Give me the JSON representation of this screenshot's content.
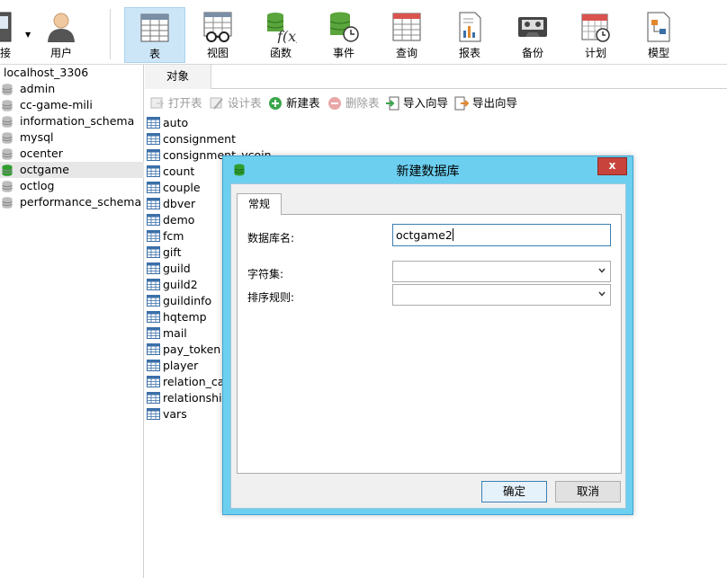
{
  "toolbar": {
    "partial_label": "接",
    "items": [
      {
        "label": "用户",
        "icon": "user-icon"
      },
      {
        "label": "表",
        "icon": "table-icon"
      },
      {
        "label": "视图",
        "icon": "view-icon"
      },
      {
        "label": "函数",
        "icon": "function-icon"
      },
      {
        "label": "事件",
        "icon": "event-icon"
      },
      {
        "label": "查询",
        "icon": "query-icon"
      },
      {
        "label": "报表",
        "icon": "report-icon"
      },
      {
        "label": "备份",
        "icon": "backup-icon"
      },
      {
        "label": "计划",
        "icon": "schedule-icon"
      },
      {
        "label": "模型",
        "icon": "model-icon"
      }
    ]
  },
  "tree": {
    "connection": "localhost_3306",
    "databases": [
      "admin",
      "cc-game-mili",
      "information_schema",
      "mysql",
      "ocenter",
      "octgame",
      "octlog",
      "performance_schema"
    ],
    "selected": "octgame"
  },
  "object_tab": "对象",
  "object_toolbar": {
    "open": "打开表",
    "design": "设计表",
    "new": "新建表",
    "delete": "删除表",
    "import": "导入向导",
    "export": "导出向导"
  },
  "tables": [
    "auto",
    "consignment",
    "consignment_ycoin",
    "count",
    "couple",
    "dbver",
    "demo",
    "fcm",
    "gift",
    "guild",
    "guild2",
    "guildinfo",
    "hqtemp",
    "mail",
    "pay_token",
    "player",
    "relation_cac",
    "relationship",
    "vars"
  ],
  "dialog": {
    "title": "新建数据库",
    "close": "x",
    "tab": "常规",
    "db_name_label": "数据库名:",
    "db_name_value": "octgame2",
    "charset_label": "字符集:",
    "charset_value": "",
    "collation_label": "排序规则:",
    "collation_value": "",
    "ok": "确定",
    "cancel": "取消"
  },
  "colors": {
    "dialog_frame": "#6ccff0",
    "close_button": "#c7433b",
    "db_icon": "#4f9a3a",
    "selected_db_icon": "#2f9e2f",
    "table_icon": "#3b6fa8"
  }
}
